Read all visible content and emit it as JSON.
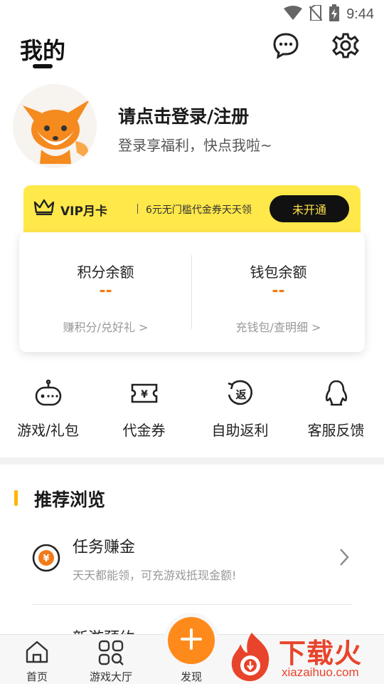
{
  "status_bar": {
    "time": "9:44"
  },
  "header": {
    "title": "我的"
  },
  "profile": {
    "login_title": "请点击登录/注册",
    "login_subtitle": "登录享福利，快点我啦~"
  },
  "vip": {
    "label": "VIP月卡",
    "description": "6元无门槛代金券天天领",
    "button": "未开通",
    "accent": "#ffe84a"
  },
  "balances": {
    "points": {
      "title": "积分余额",
      "value": "--",
      "link": "赚积分/兑好礼 >"
    },
    "wallet": {
      "title": "钱包余额",
      "value": "--",
      "link": "充钱包/查明细 >"
    }
  },
  "quick_actions": [
    {
      "label": "游戏/礼包",
      "icon": "gamepad-icon"
    },
    {
      "label": "代金券",
      "icon": "voucher-icon"
    },
    {
      "label": "自助返利",
      "icon": "rebate-icon"
    },
    {
      "label": "客服反馈",
      "icon": "penguin-icon"
    }
  ],
  "recommend": {
    "title": "推荐浏览",
    "task": {
      "title": "任务赚金",
      "subtitle": "天天都能领，可充游戏抵现金额!"
    },
    "next_partial": "新游预约"
  },
  "bottom_nav": [
    {
      "label": "首页",
      "icon": "home-icon"
    },
    {
      "label": "游戏大厅",
      "icon": "grid-search-icon"
    },
    {
      "label": "发现",
      "icon": "plus-icon"
    }
  ],
  "watermark": {
    "text": "下载火",
    "domain": "xiazaihuo.com"
  }
}
